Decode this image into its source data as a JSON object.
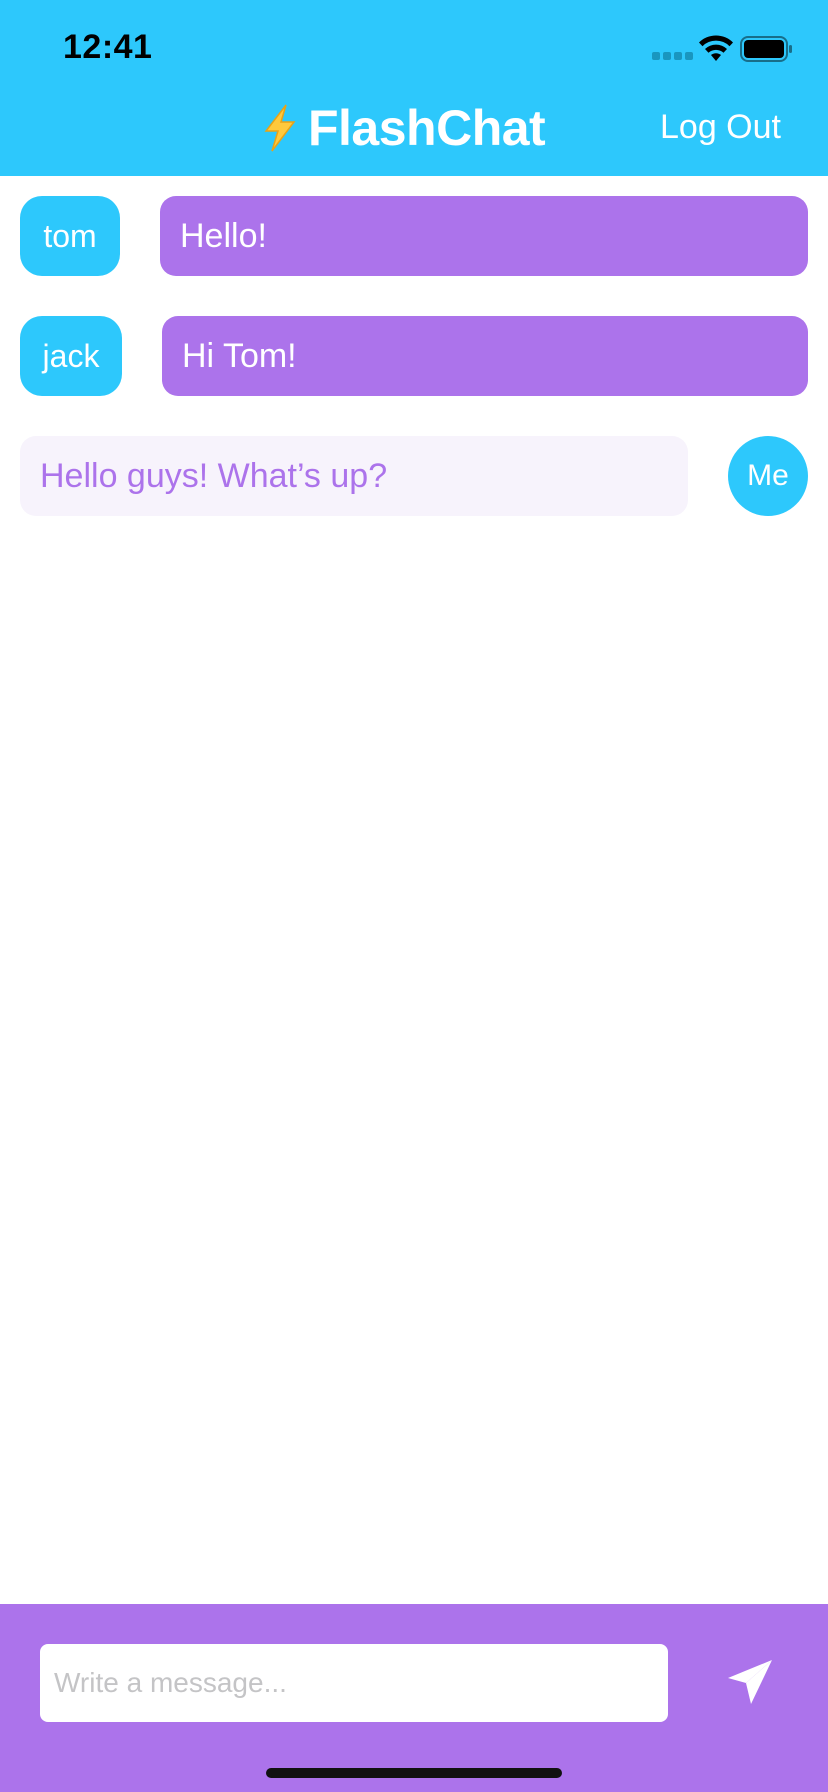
{
  "status_bar": {
    "time": "12:41"
  },
  "nav": {
    "title": "FlashChat",
    "logout_label": "Log Out"
  },
  "messages": [
    {
      "sender": "tom",
      "text": "Hello!",
      "from_me": false
    },
    {
      "sender": "jack",
      "text": "Hi Tom!",
      "from_me": false
    },
    {
      "sender": "Me",
      "text": "Hello guys! What’s up?",
      "from_me": true
    }
  ],
  "composer": {
    "placeholder": "Write a message...",
    "value": ""
  },
  "icons": {
    "title_icon": "lightning-bolt-icon",
    "send": "paper-plane-icon",
    "wifi": "wifi-icon",
    "battery": "battery-icon",
    "signal": "signal-icon"
  },
  "colors": {
    "brand_blue": "#2dc8fc",
    "brand_purple": "#ac73eb",
    "bubble_light": "#f7f3fc",
    "text_white": "#ffffff"
  }
}
